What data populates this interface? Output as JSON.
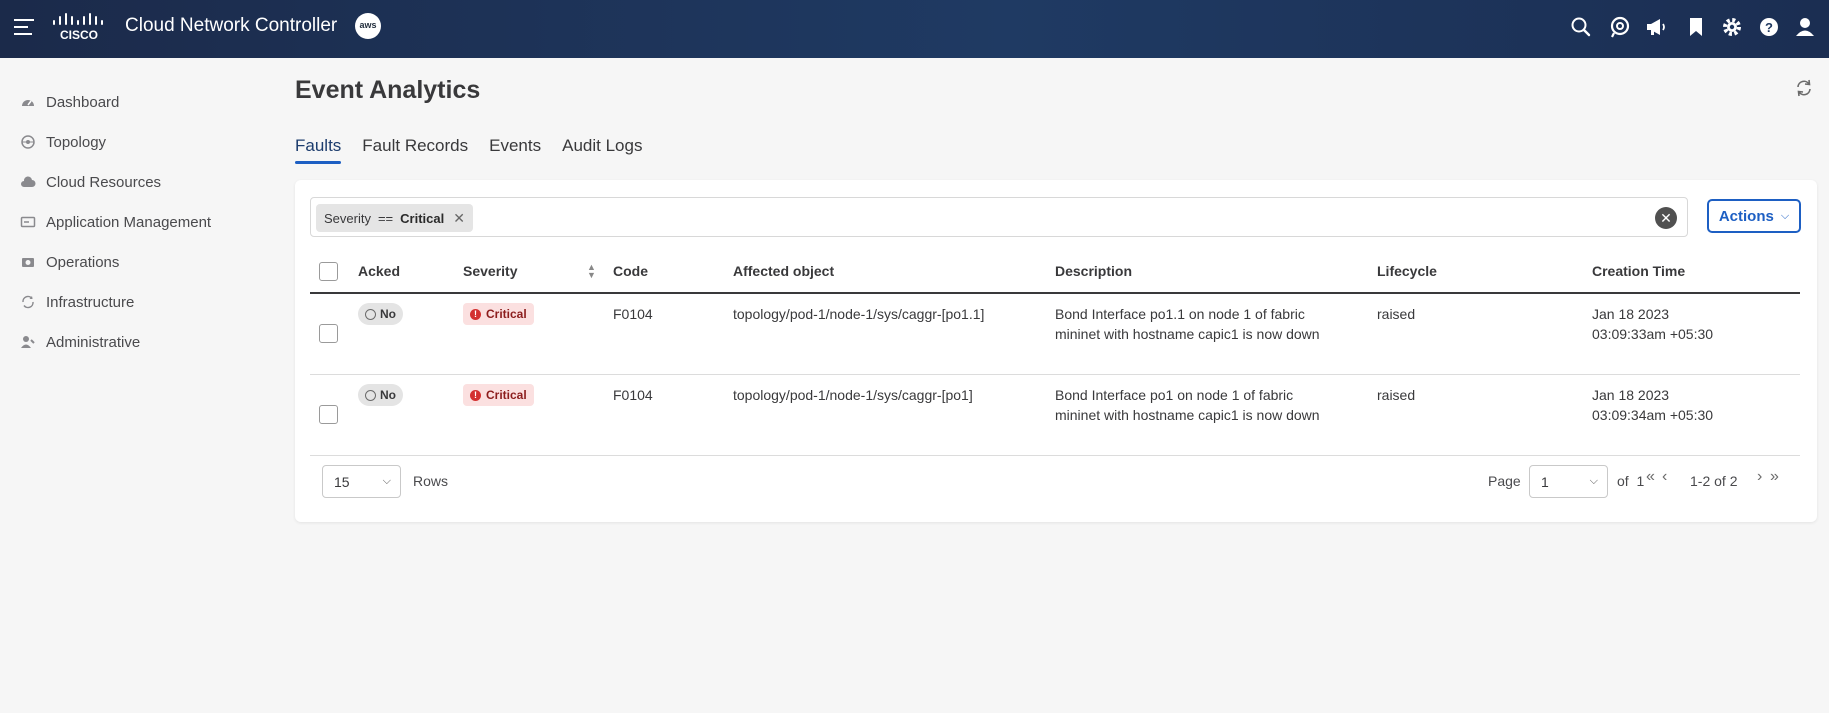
{
  "header": {
    "app_title": "Cloud Network Controller",
    "logo_text": "CISCO",
    "cloud_badge": "aws",
    "icons": [
      "search-icon",
      "assist-icon",
      "announcement-icon",
      "bookmark-icon",
      "settings-icon",
      "help-icon",
      "user-icon"
    ]
  },
  "sidebar": {
    "items": [
      {
        "label": "Dashboard",
        "icon": "dashboard-icon"
      },
      {
        "label": "Topology",
        "icon": "topology-icon"
      },
      {
        "label": "Cloud Resources",
        "icon": "cloud-icon"
      },
      {
        "label": "Application Management",
        "icon": "application-icon"
      },
      {
        "label": "Operations",
        "icon": "operations-icon"
      },
      {
        "label": "Infrastructure",
        "icon": "infrastructure-icon"
      },
      {
        "label": "Administrative",
        "icon": "administrative-icon"
      }
    ]
  },
  "page": {
    "title": "Event Analytics",
    "tabs": [
      {
        "label": "Faults",
        "active": true
      },
      {
        "label": "Fault Records",
        "active": false
      },
      {
        "label": "Events",
        "active": false
      },
      {
        "label": "Audit Logs",
        "active": false
      }
    ]
  },
  "filter": {
    "field": "Severity",
    "operator": "==",
    "value": "Critical"
  },
  "actions_label": "Actions",
  "table": {
    "columns": [
      "Acked",
      "Severity",
      "Code",
      "Affected object",
      "Description",
      "Lifecycle",
      "Creation Time"
    ],
    "rows": [
      {
        "acked": "No",
        "severity": "Critical",
        "code": "F0104",
        "affected_object": "topology/pod-1/node-1/sys/caggr-[po1.1]",
        "description": "Bond Interface po1.1 on node 1 of fabric mininet with hostname capic1 is now down",
        "lifecycle": "raised",
        "creation_date": "Jan 18 2023",
        "creation_time": "03:09:33am +05:30"
      },
      {
        "acked": "No",
        "severity": "Critical",
        "code": "F0104",
        "affected_object": "topology/pod-1/node-1/sys/caggr-[po1]",
        "description": "Bond Interface po1 on node 1 of fabric mininet with hostname capic1 is now down",
        "lifecycle": "raised",
        "creation_date": "Jan 18 2023",
        "creation_time": "03:09:34am +05:30"
      }
    ]
  },
  "pagination": {
    "rows_per_page": "15",
    "rows_label": "Rows",
    "page_label": "Page",
    "current_page": "1",
    "of_label": "of",
    "total_pages": "1",
    "range": "1-2 of 2"
  }
}
